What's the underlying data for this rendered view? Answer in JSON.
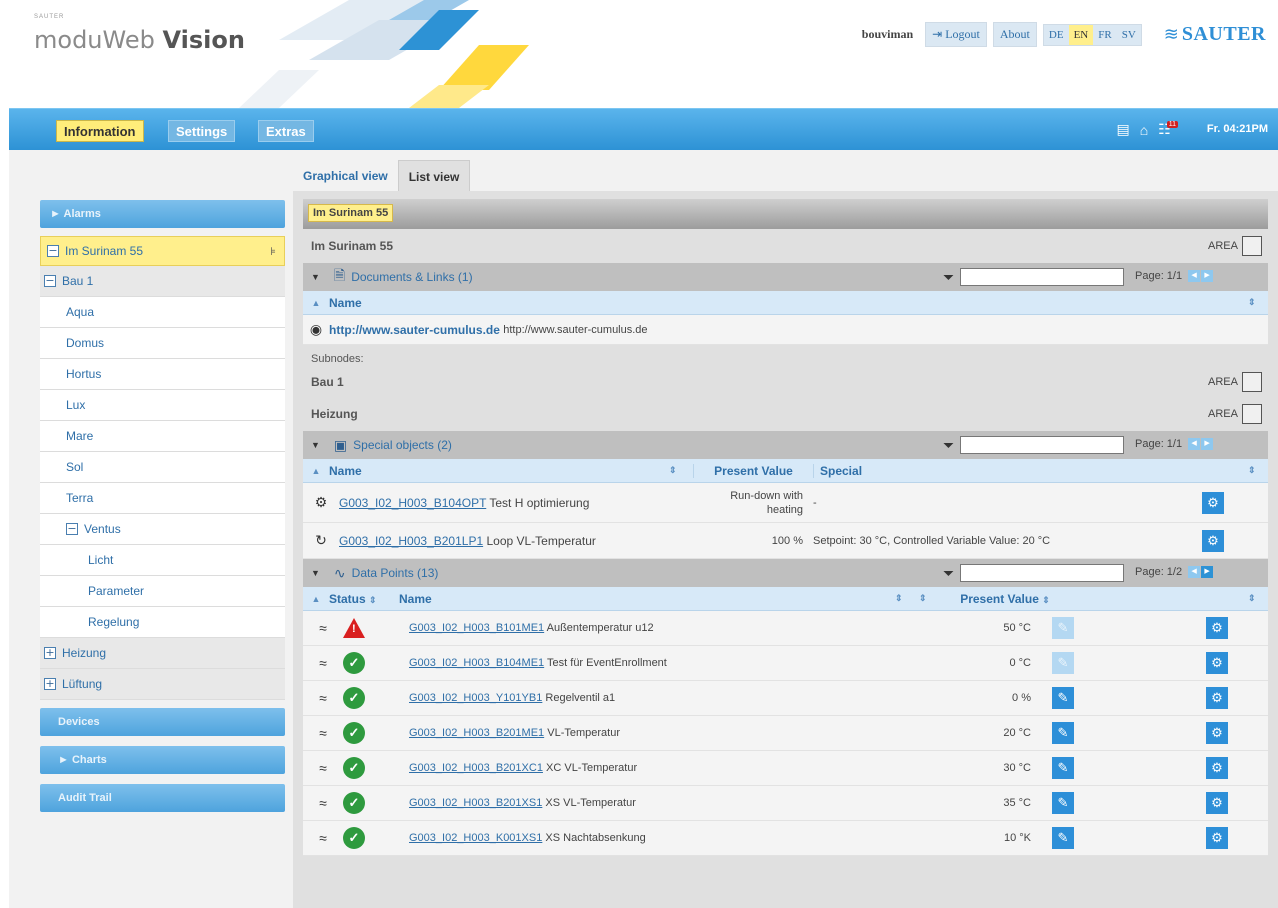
{
  "header": {
    "small_label": "SAUTER",
    "logo_regular": "moduWeb ",
    "logo_bold": "Vision",
    "user": "bouviman",
    "logout": "Logout",
    "about": "About",
    "languages": [
      "DE",
      "EN",
      "FR",
      "SV"
    ],
    "active_language": "EN",
    "brand": "SAUTER"
  },
  "navbar": {
    "tabs": [
      "Information",
      "Settings",
      "Extras"
    ],
    "active_tab": "Information",
    "alarm_badge": "11",
    "clock": "Fr. 04:21PM"
  },
  "sidebar": {
    "alarms": "Alarms",
    "root": "Im Surinam 55",
    "tree": [
      {
        "label": "Bau 1",
        "level": 1,
        "box": "−"
      },
      {
        "label": "Aqua",
        "level": 2
      },
      {
        "label": "Domus",
        "level": 2
      },
      {
        "label": "Hortus",
        "level": 2
      },
      {
        "label": "Lux",
        "level": 2
      },
      {
        "label": "Mare",
        "level": 2
      },
      {
        "label": "Sol",
        "level": 2
      },
      {
        "label": "Terra",
        "level": 2
      },
      {
        "label": "Ventus",
        "level": 2,
        "box": "−"
      },
      {
        "label": "Licht",
        "level": 3
      },
      {
        "label": "Parameter",
        "level": 3
      },
      {
        "label": "Regelung",
        "level": 3
      },
      {
        "label": "Heizung",
        "level": 1,
        "box": "+"
      },
      {
        "label": "Lüftung",
        "level": 1,
        "box": "+"
      }
    ],
    "devices": "Devices",
    "charts": "Charts",
    "audit_trail": "Audit Trail"
  },
  "views": {
    "graphical": "Graphical view",
    "list": "List view"
  },
  "main": {
    "breadcrumb": "Im Surinam 55",
    "title": "Im Surinam 55",
    "area_label": "AREA",
    "docs": {
      "title": "Documents & Links (1)",
      "page": "Page: 1/1",
      "col_name": "Name",
      "link": "http://www.sauter-cumulus.de",
      "link_desc": "http://www.sauter-cumulus.de"
    },
    "subnodes_label": "Subnodes:",
    "subnodes": [
      "Bau 1",
      "Heizung"
    ],
    "special": {
      "title": "Special objects (2)",
      "page": "Page: 1/1",
      "cols": {
        "name": "Name",
        "present": "Present Value",
        "special": "Special"
      },
      "rows": [
        {
          "id": "G003_I02_H003_B104OPT",
          "desc": "Test H optimierung",
          "value_line1": "Run-down with",
          "value_line2": "heating",
          "special": "-"
        },
        {
          "id": "G003_I02_H003_B201LP1",
          "desc": "Loop VL-Temperatur",
          "value_line1": "100 %",
          "value_line2": "",
          "special": "Setpoint: 30 °C, Controlled Variable Value: 20 °C"
        }
      ]
    },
    "datapoints": {
      "title": "Data Points (13)",
      "page": "Page: 1/2",
      "cols": {
        "status": "Status",
        "name": "Name",
        "present": "Present Value"
      },
      "rows": [
        {
          "id": "G003_I02_H003_B101ME1",
          "desc": "Außentemperatur u12",
          "value": "50 °C",
          "status": "alarm",
          "edit": "dim"
        },
        {
          "id": "G003_I02_H003_B104ME1",
          "desc": "Test für EventEnrollment",
          "value": "0 °C",
          "status": "ok",
          "edit": "dim"
        },
        {
          "id": "G003_I02_H003_Y101YB1",
          "desc": "Regelventil a1",
          "value": "0 %",
          "status": "ok",
          "edit": "on"
        },
        {
          "id": "G003_I02_H003_B201ME1",
          "desc": "VL-Temperatur",
          "value": "20 °C",
          "status": "ok",
          "edit": "on"
        },
        {
          "id": "G003_I02_H003_B201XC1",
          "desc": "XC VL-Temperatur",
          "value": "30 °C",
          "status": "ok",
          "edit": "on"
        },
        {
          "id": "G003_I02_H003_B201XS1",
          "desc": "XS VL-Temperatur",
          "value": "35 °C",
          "status": "ok",
          "edit": "on"
        },
        {
          "id": "G003_I02_H003_K001XS1",
          "desc": "XS Nachtabsenkung",
          "value": "10 °K",
          "status": "ok",
          "edit": "on"
        }
      ]
    }
  }
}
